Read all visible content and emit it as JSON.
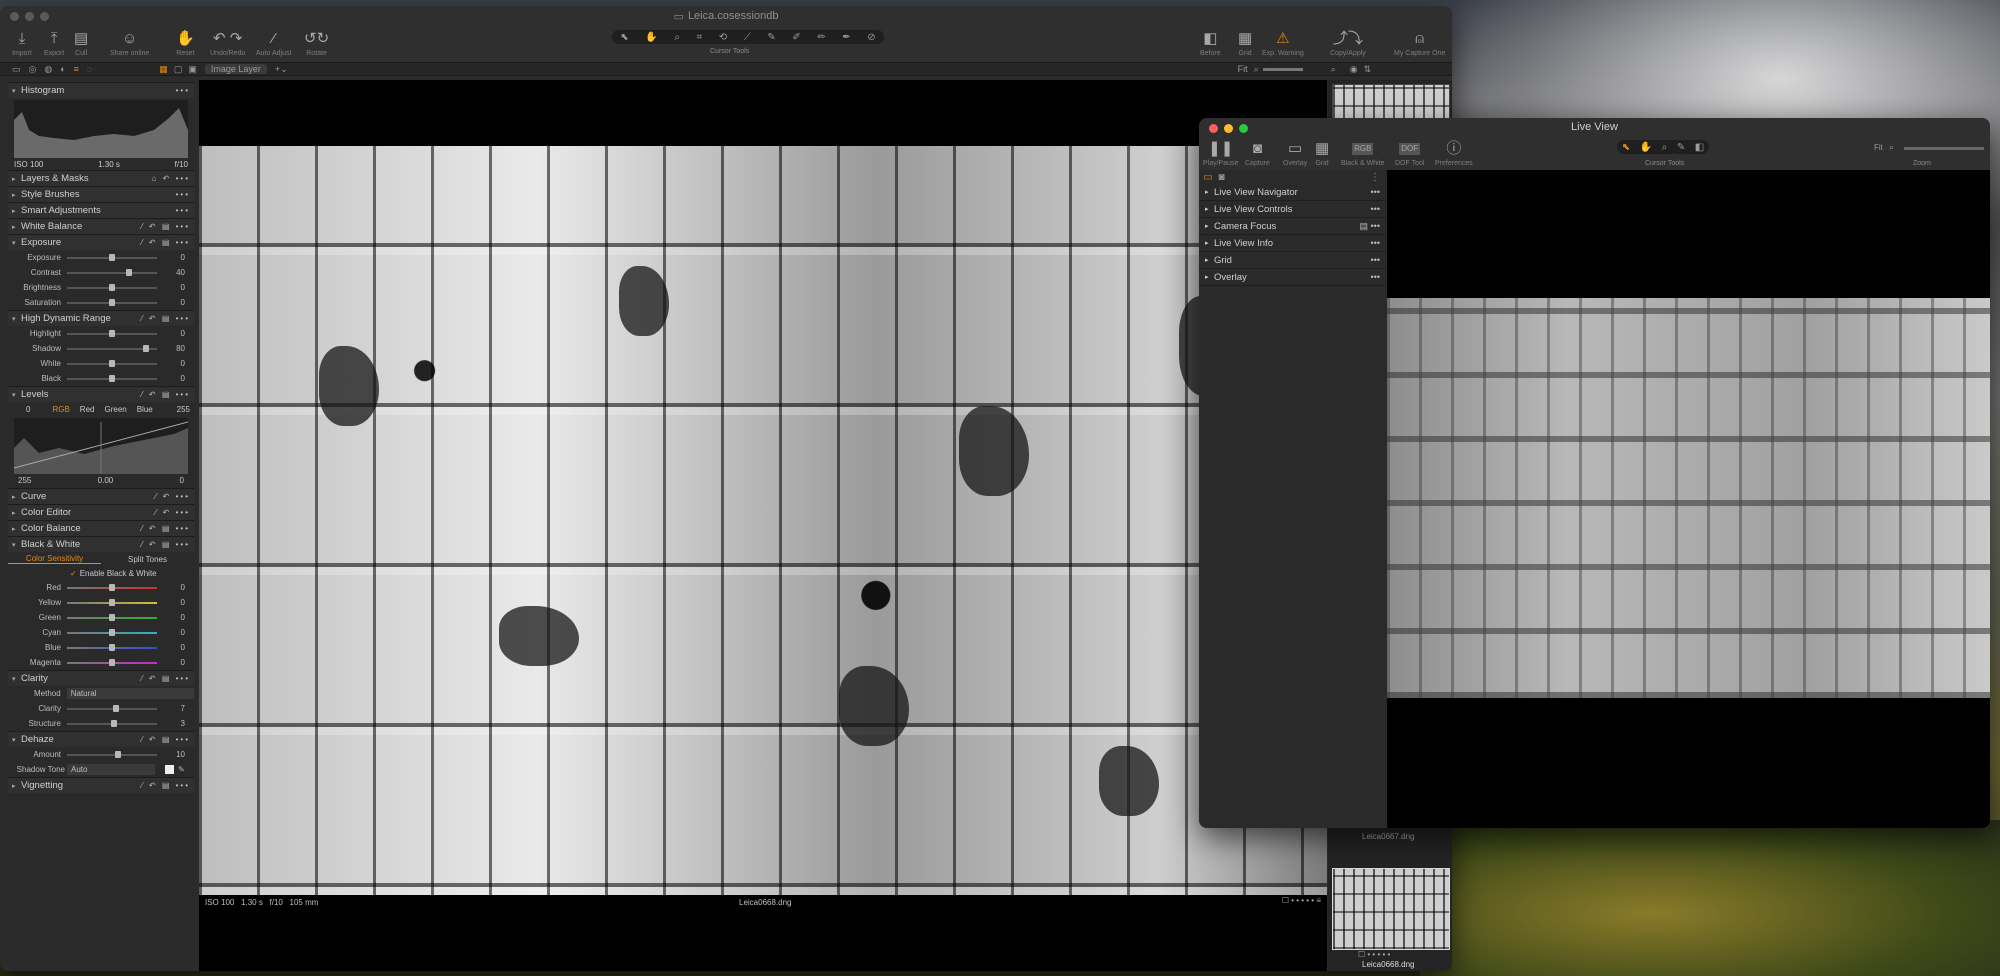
{
  "main": {
    "title": "Leica.cosessiondb",
    "toolbar": {
      "import": "Import",
      "export": "Export",
      "cull": "Cull",
      "share": "Share online",
      "reset": "Reset",
      "undo_redo": "Undo/Redo",
      "auto_adjust": "Auto Adjust",
      "rotate": "Rotate",
      "cursor_tools": "Cursor Tools",
      "before": "Before",
      "grid": "Grid",
      "exp_warning": "Exp. Warning",
      "copy_apply": "Copy/Apply",
      "my_capture_one": "My Capture One"
    },
    "layer_select": "Image Layer",
    "fit_label": "Fit",
    "histogram": {
      "title": "Histogram",
      "iso": "ISO 100",
      "shutter": "1.30 s",
      "aperture": "f/10"
    },
    "sections": {
      "layers": "Layers & Masks",
      "style_brushes": "Style Brushes",
      "smart_adj": "Smart Adjustments",
      "white_balance": "White Balance",
      "exposure": "Exposure",
      "hdr": "High Dynamic Range",
      "levels": "Levels",
      "curve": "Curve",
      "color_editor": "Color Editor",
      "color_balance": "Color Balance",
      "bw": "Black & White",
      "clarity": "Clarity",
      "dehaze": "Dehaze",
      "vignetting": "Vignetting"
    },
    "exposure_rows": [
      {
        "label": "Exposure",
        "value": "0",
        "pos": 0.5
      },
      {
        "label": "Contrast",
        "value": "40",
        "pos": 0.7
      },
      {
        "label": "Brightness",
        "value": "0",
        "pos": 0.5
      },
      {
        "label": "Saturation",
        "value": "0",
        "pos": 0.5
      }
    ],
    "hdr_rows": [
      {
        "label": "Highlight",
        "value": "0",
        "pos": 0.5
      },
      {
        "label": "Shadow",
        "value": "80",
        "pos": 0.9
      },
      {
        "label": "White",
        "value": "0",
        "pos": 0.5
      },
      {
        "label": "Black",
        "value": "0",
        "pos": 0.5
      }
    ],
    "levels": {
      "left": "0",
      "right": "255",
      "tabs": [
        "RGB",
        "Red",
        "Green",
        "Blue"
      ],
      "bottom_left": "255",
      "bottom_mid": "0.00",
      "bottom_right": "0"
    },
    "bw": {
      "tab1": "Color Sensitivity",
      "tab2": "Split Tones",
      "enable": "Enable Black & White"
    },
    "bw_rows": [
      {
        "label": "Red",
        "value": "0",
        "color": "#d03030"
      },
      {
        "label": "Yellow",
        "value": "0",
        "color": "#d0c030"
      },
      {
        "label": "Green",
        "value": "0",
        "color": "#30b030"
      },
      {
        "label": "Cyan",
        "value": "0",
        "color": "#30b0c0"
      },
      {
        "label": "Blue",
        "value": "0",
        "color": "#3050d0"
      },
      {
        "label": "Magenta",
        "value": "0",
        "color": "#c030c0"
      }
    ],
    "clarity": {
      "method_label": "Method",
      "method_value": "Natural",
      "rows": [
        {
          "label": "Clarity",
          "value": "7",
          "pos": 0.55
        },
        {
          "label": "Structure",
          "value": "3",
          "pos": 0.52
        }
      ]
    },
    "dehaze": {
      "amount_label": "Amount",
      "amount_value": "10",
      "shadow_label": "Shadow Tone",
      "shadow_value": "Auto"
    },
    "viewer_info": {
      "iso": "ISO 100",
      "shutter": "1.30 s",
      "aperture": "f/10",
      "focal": "105 mm",
      "filename": "Leica0668.dng"
    },
    "browser": {
      "prev_name": "Leica0667.dng",
      "cur_name": "Leica0668.dng"
    }
  },
  "live": {
    "title": "Live View",
    "toolbar": {
      "play_pause": "Play/Pause",
      "capture": "Capture",
      "overlay": "Overlay",
      "grid": "Grid",
      "bw": "Black & White",
      "dof": "DOF Tool",
      "prefs": "Preferences",
      "cursor_tools": "Cursor Tools",
      "fit": "Fit",
      "zoom": "Zoom",
      "rgb": "RGB",
      "dof_badge": "DOF"
    },
    "sections": [
      "Live View Navigator",
      "Live View Controls",
      "Camera Focus",
      "Live View Info",
      "Grid",
      "Overlay"
    ]
  },
  "colors": {
    "accent": "#e08a1a",
    "panel": "#2b2b2b",
    "viewer": "#000000"
  }
}
